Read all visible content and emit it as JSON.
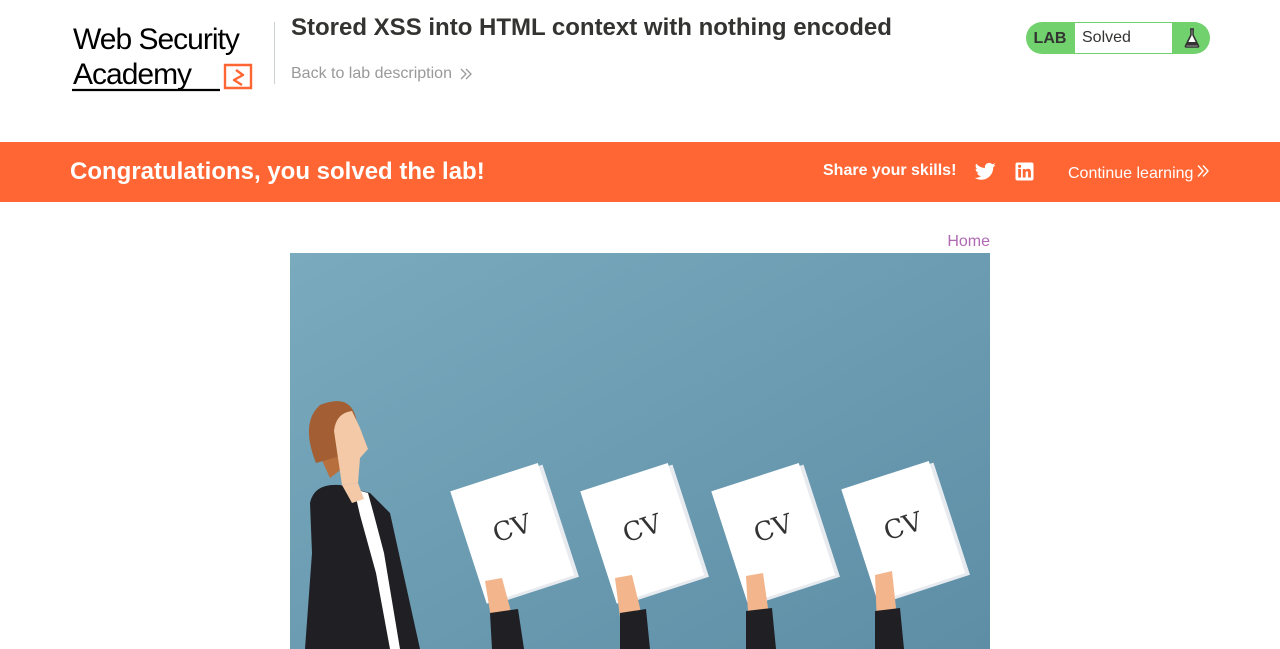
{
  "header": {
    "logo_text_line1": "Web Security",
    "logo_text_line2": "Academy",
    "lab_title": "Stored XSS into HTML context with nothing encoded",
    "back_link": "Back to lab description",
    "lab_tag": "LAB",
    "lab_status": "Solved",
    "status_color": "#70d16d"
  },
  "banner": {
    "message": "Congratulations, you solved the lab!",
    "share_label": "Share your skills!",
    "continue_label": "Continue learning",
    "color": "#ff6633"
  },
  "main": {
    "home_link": "Home",
    "image": {
      "cv_label": "CV"
    }
  }
}
